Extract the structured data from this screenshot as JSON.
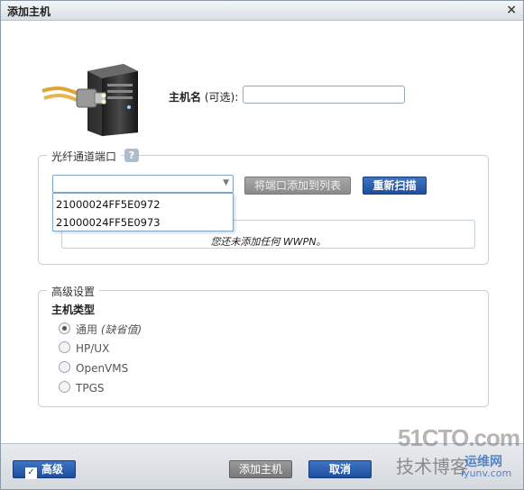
{
  "window": {
    "title": "添加主机",
    "close_glyph": "×"
  },
  "host": {
    "label_bold": "主机名",
    "label_rest": " (可选):",
    "value": ""
  },
  "fc_ports": {
    "legend": "光纤通道端口",
    "help": "?",
    "combo_value": "",
    "options": [
      "21000024FF5E0972",
      "21000024FF5E0973"
    ],
    "add_button": "将端口添加到列表",
    "rescan_button": "重新扫描",
    "empty_message": "您还未添加任何 WWPN。"
  },
  "advanced": {
    "legend": "高级设置",
    "host_type_label": "主机类型",
    "options": [
      {
        "label": "通用",
        "suffix": " (缺省值)",
        "checked": true
      },
      {
        "label": "HP/UX",
        "suffix": "",
        "checked": false
      },
      {
        "label": "OpenVMS",
        "suffix": "",
        "checked": false
      },
      {
        "label": "TPGS",
        "suffix": "",
        "checked": false
      }
    ]
  },
  "footer": {
    "advanced_toggle": "高级",
    "advanced_checked": true,
    "add_host_button": "添加主机",
    "cancel_button": "取消"
  },
  "watermark": {
    "line1": "51CTO.com",
    "line2": "技术博客",
    "line3": "运维网",
    "line4": "iyunv.com"
  }
}
